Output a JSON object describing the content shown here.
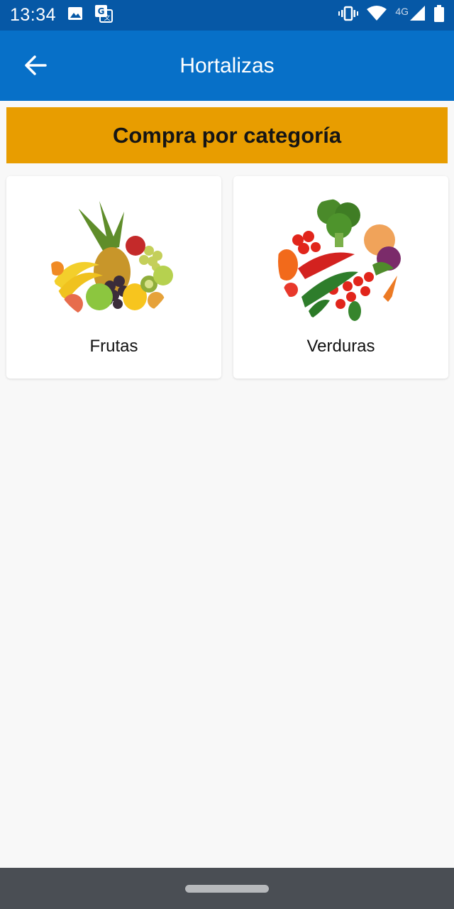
{
  "status_bar": {
    "time": "13:34",
    "network": "4G",
    "icons": [
      "image-icon",
      "translate-icon",
      "vibrate-icon",
      "wifi-icon",
      "cellular-signal-icon",
      "battery-icon"
    ]
  },
  "app_bar": {
    "title": "Hortalizas",
    "back_icon": "arrow-left-icon"
  },
  "banner": {
    "label": "Compra por categoría",
    "color": "#e89d00"
  },
  "categories": [
    {
      "label": "Frutas",
      "image": "fruit-basket"
    },
    {
      "label": "Verduras",
      "image": "vegetable-basket"
    }
  ],
  "colors": {
    "status_bar": "#0658a6",
    "app_bar": "#0770c8",
    "background": "#f8f8f8",
    "nav_bar": "#4a4e54"
  }
}
